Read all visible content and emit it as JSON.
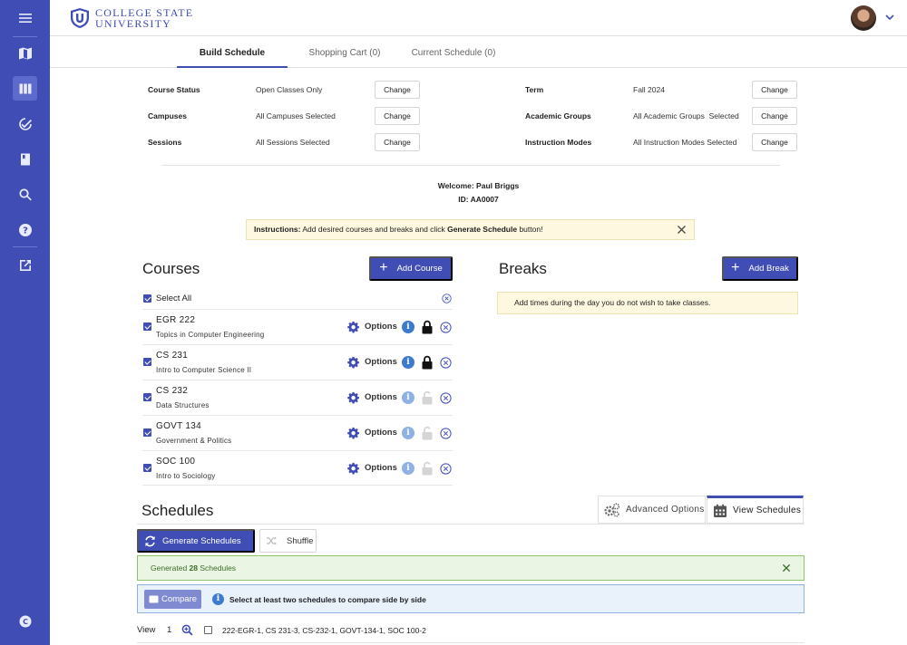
{
  "app": {
    "logo_line1": "COLLEGE STATE",
    "logo_line2": "UNIVERSITY",
    "brand_color": "#3f4db5"
  },
  "rail": {
    "icons": [
      "menu-icon",
      "map-icon",
      "schedule-icon",
      "check-circle-icon",
      "book-icon",
      "search-icon",
      "help-icon",
      "external-link-icon",
      "copyright-icon"
    ],
    "active": "schedule-icon"
  },
  "tabs": [
    {
      "label": "Build Schedule",
      "active": true
    },
    {
      "label": "Shopping Cart (0)",
      "active": false
    },
    {
      "label": "Current Schedule (0)",
      "active": false
    }
  ],
  "filters": {
    "course_status": {
      "label": "Course Status",
      "value": "Open Classes Only"
    },
    "campuses": {
      "label": "Campuses",
      "value": "All Campuses Selected"
    },
    "sessions": {
      "label": "Sessions",
      "value": "All Sessions Selected"
    },
    "term": {
      "label": "Term",
      "value": "Fall 2024"
    },
    "academic_groups": {
      "label": "Academic Groups",
      "value": "All Academic Groups  Selected"
    },
    "instruction_modes": {
      "label": "Instruction Modes",
      "value": "All Instruction Modes Selected"
    },
    "change_label": "Change"
  },
  "user": {
    "welcome": "Welcome: Paul Briggs",
    "id": "ID: AA0007"
  },
  "instructions": {
    "prefix": "Instructions:",
    "text_before": " Add desired courses and breaks and click ",
    "button_name": "Generate Schedule",
    "text_after": " button!"
  },
  "courses": {
    "title": "Courses",
    "add_label": "Add Course",
    "select_all": "Select All",
    "options_label": "Options",
    "items": [
      {
        "code": "EGR 222",
        "name": "Topics in Computer Engineering",
        "locked": true
      },
      {
        "code": "CS 231",
        "name": "Intro to Computer Science II",
        "locked": true
      },
      {
        "code": "CS 232",
        "name": "Data Structures",
        "locked": false
      },
      {
        "code": "GOVT 134",
        "name": "Government & Politics",
        "locked": false
      },
      {
        "code": "SOC 100",
        "name": "Intro to Sociology",
        "locked": false
      }
    ]
  },
  "breaks": {
    "title": "Breaks",
    "add_label": "Add Break",
    "note": "Add times during the day you do not wish to take classes."
  },
  "schedules": {
    "title": "Schedules",
    "advanced_options": "Advanced Options",
    "view_schedules": "View Schedules",
    "generate_label": "Generate Schedules",
    "shuffle_label": "Shuffle",
    "generated_prefix": "Generated ",
    "generated_count": "28",
    "generated_suffix": " Schedules",
    "compare_label": "Compare",
    "compare_hint": "Select at least two schedules to compare side by side",
    "view_label": "View",
    "view_number": "1",
    "first_schedule": "222-EGR-1, CS 231-3, CS-232-1, GOVT-134-1, SOC 100-2"
  }
}
